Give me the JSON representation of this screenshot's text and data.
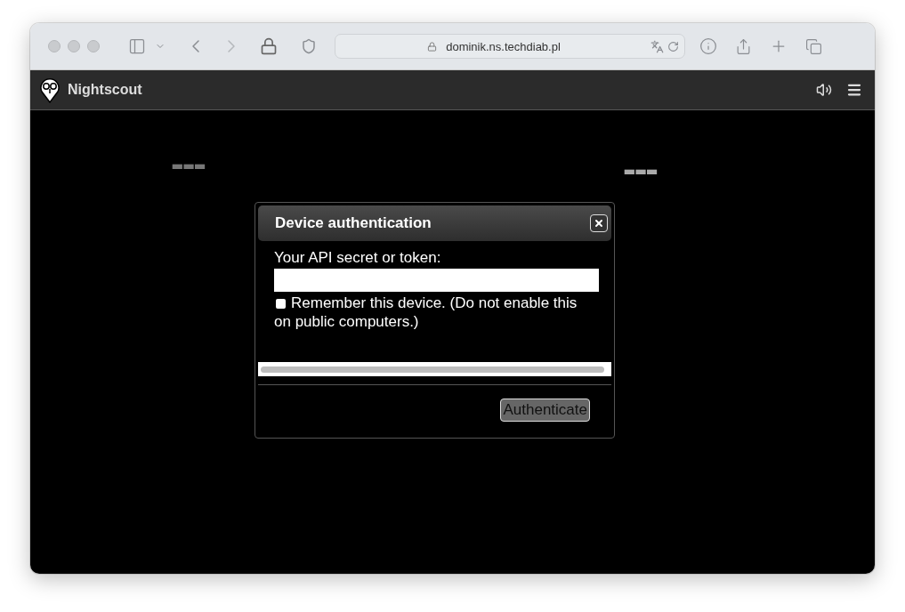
{
  "browser": {
    "url": "dominik.ns.techdiab.pl"
  },
  "app": {
    "title": "Nightscout"
  },
  "glucose": {
    "text": "---"
  },
  "delta": {
    "text": "---"
  },
  "dialog": {
    "title": "Device authentication",
    "field_label": "Your API secret or token:",
    "remember": {
      "label": "Remember this device. (Do not enable this on public computers.)",
      "checked": false
    },
    "button": "Authenticate"
  }
}
